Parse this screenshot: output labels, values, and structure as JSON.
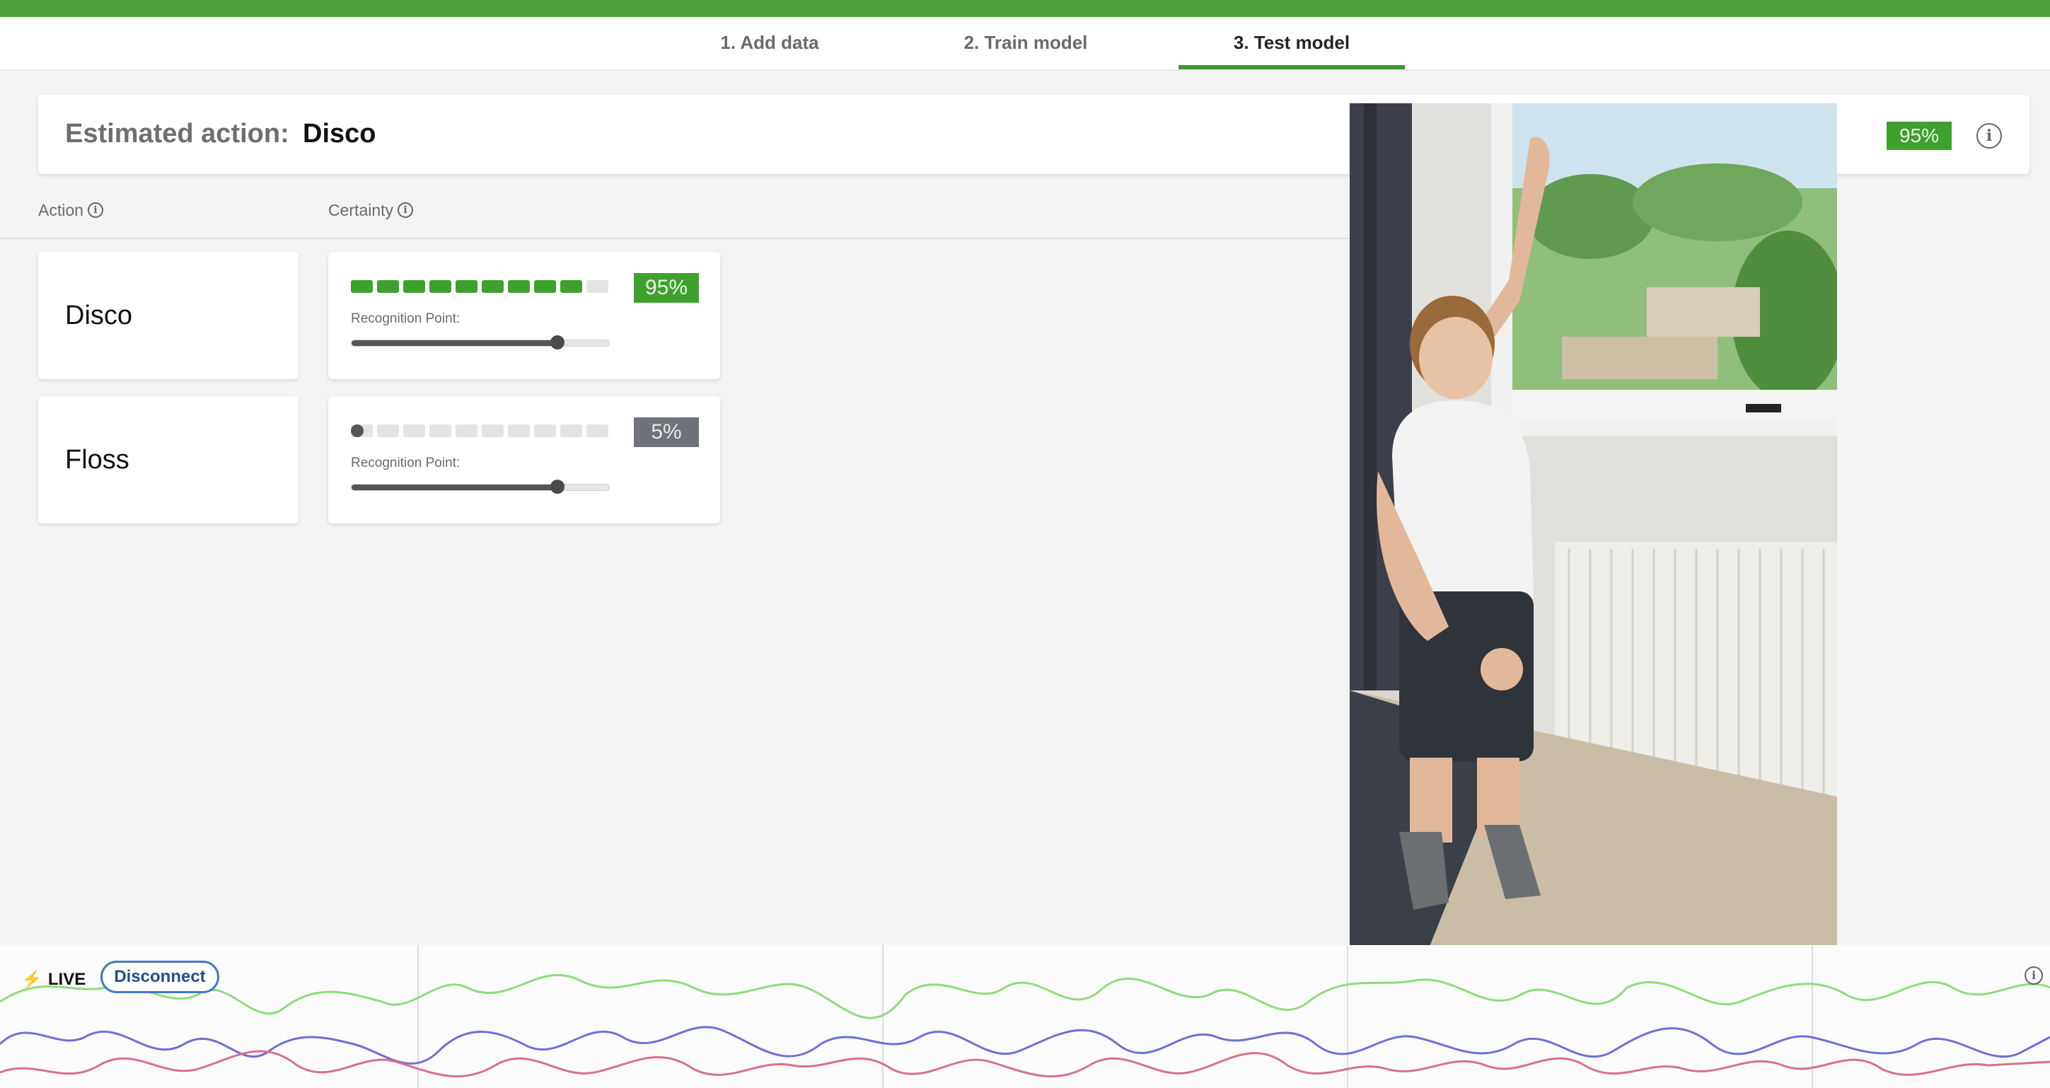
{
  "tabs": [
    {
      "label": "1. Add data",
      "active": false
    },
    {
      "label": "2. Train model",
      "active": false
    },
    {
      "label": "3. Test model",
      "active": true
    }
  ],
  "estimate": {
    "label": "Estimated action:",
    "value": "Disco",
    "certainty": "95%"
  },
  "columns": {
    "action": "Action",
    "certainty": "Certainty"
  },
  "actions": [
    {
      "name": "Disco",
      "certainty": "95%",
      "certainty_value": 0.95,
      "recognition_label": "Recognition Point:",
      "recognition_point": 0.8,
      "badge_color": "#3ea12e"
    },
    {
      "name": "Floss",
      "certainty": "5%",
      "certainty_value": 0.05,
      "recognition_label": "Recognition Point:",
      "recognition_point": 0.8,
      "badge_color": "#6f7278"
    }
  ],
  "live": {
    "label": "LIVE",
    "button": "Disconnect"
  },
  "colors": {
    "brand_green": "#4e9f3d",
    "accent_green": "#3ea12e",
    "disconnect_blue": "#3e7bbf",
    "wave_green": "#8ddc7a",
    "wave_blue": "#6f6fd6",
    "wave_red": "#d9708a"
  },
  "icons": {
    "estimate_info": "info-icon",
    "action_info": "info-icon",
    "certainty_info": "info-icon",
    "live": "lightning-bolt-icon",
    "live_info": "info-icon"
  }
}
